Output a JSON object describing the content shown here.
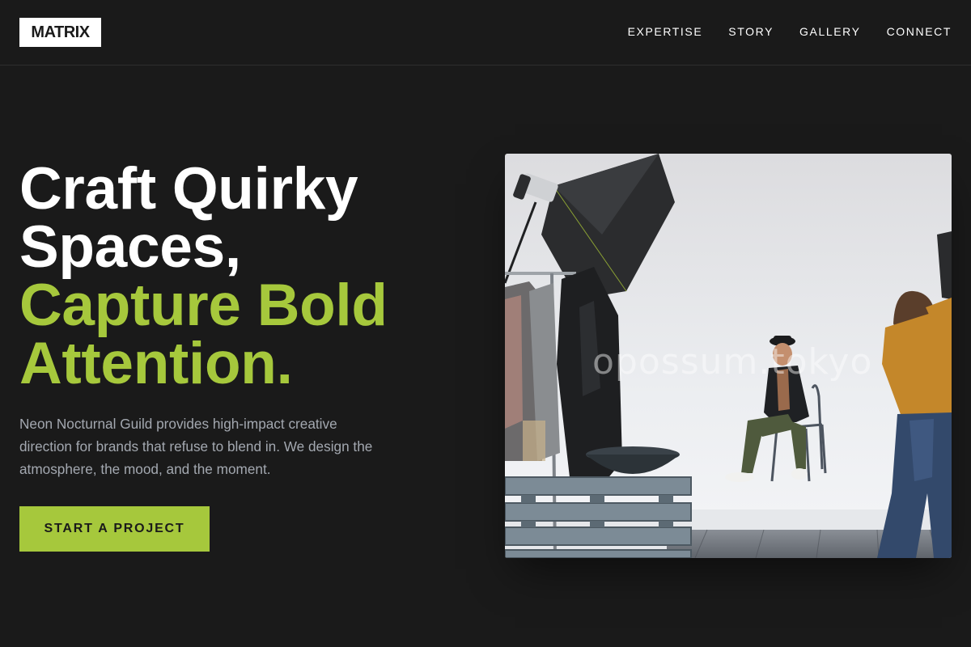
{
  "header": {
    "logo": "MATRIX",
    "nav": [
      {
        "label": "EXPERTISE"
      },
      {
        "label": "STORY"
      },
      {
        "label": "GALLERY"
      },
      {
        "label": "CONNECT"
      }
    ]
  },
  "hero": {
    "headline": {
      "line1": "Craft Quirky",
      "line2": "Spaces,",
      "accent1": "Capture Bold",
      "accent2": "Attention."
    },
    "description": "Neon Nocturnal Guild provides high-impact creative direction for brands that refuse to blend in. We design the atmosphere, the mood, and the moment.",
    "cta_label": "START A PROJECT",
    "photo": {
      "watermark": "opossum.tokyo"
    }
  },
  "colors": {
    "background": "#1a1a1a",
    "accent": "#a6c83c",
    "text": "#ffffff",
    "muted_text": "#a3a8b0"
  }
}
